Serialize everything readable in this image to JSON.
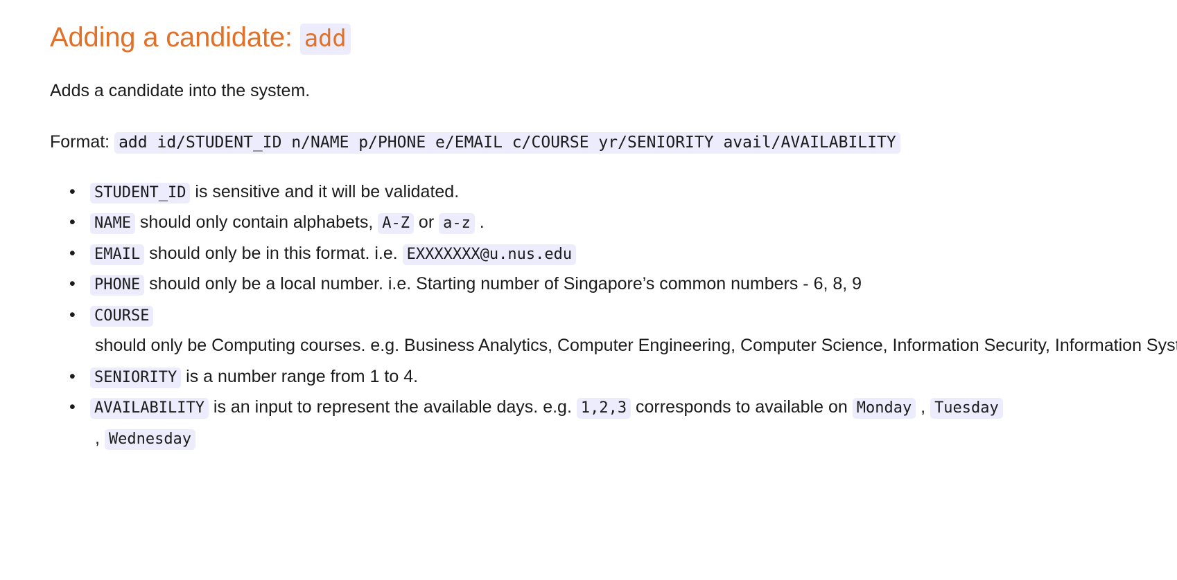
{
  "heading": {
    "text": "Adding a candidate:",
    "command": "add"
  },
  "description": "Adds a candidate into the system.",
  "format": {
    "label": "Format:",
    "command": "add id/STUDENT_ID n/NAME p/PHONE e/EMAIL c/COURSE yr/SENIORITY avail/AVAILABILITY"
  },
  "notes": [
    {
      "code": "STUDENT_ID",
      "text": " is sensitive and it will be validated."
    },
    {
      "code": "NAME",
      "text": " should only contain alphabets, ",
      "code2": "A-Z",
      "mid": " or ",
      "code3": "a-z",
      "tail": " ."
    },
    {
      "code": "EMAIL",
      "text": " should only be in this format. i.e. ",
      "code2": "EXXXXXXX@u.nus.edu"
    },
    {
      "code": "PHONE",
      "text": " should only be a local number. i.e. Starting number of Singapore’s common numbers - 6, 8, 9"
    },
    {
      "code": "COURSE",
      "text": " should only be Computing courses. e.g. Business Analytics, Computer Engineering, Computer Science, Information Security, Information Systems"
    },
    {
      "code": "SENIORITY",
      "text": " is a number range from 1 to 4."
    },
    {
      "code": "AVAILABILITY",
      "text": " is an input to represent the available days. e.g. ",
      "code2": "1,2,3",
      "mid": " corresponds to available on ",
      "code3": "Monday",
      "sep1": " , ",
      "code4": "Tuesday",
      "sep2": " , ",
      "code5": "Wednesday"
    }
  ],
  "colors": {
    "heading": "#e0712a",
    "code_background": "#edecfc",
    "text": "#1b1b1b",
    "page_background": "#ffffff"
  }
}
